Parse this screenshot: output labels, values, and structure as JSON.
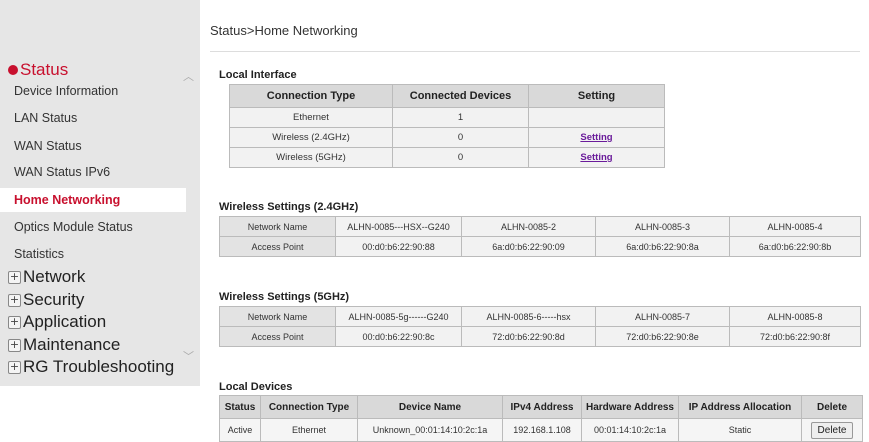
{
  "breadcrumb": "Status>Home Networking",
  "sidebar": {
    "status_label": "Status",
    "status_items": [
      "Device Information",
      "LAN Status",
      "WAN Status",
      "WAN Status IPv6",
      "Home Networking",
      "Optics Module Status",
      "Statistics"
    ],
    "categories": [
      "Network",
      "Security",
      "Application",
      "Maintenance",
      "RG Troubleshooting"
    ]
  },
  "local_interface": {
    "title": "Local Interface",
    "headers": [
      "Connection Type",
      "Connected Devices",
      "Setting"
    ],
    "rows": [
      {
        "type": "Ethernet",
        "devices": "1",
        "setting": ""
      },
      {
        "type": "Wireless (2.4GHz)",
        "devices": "0",
        "setting": "Setting"
      },
      {
        "type": "Wireless (5GHz)",
        "devices": "0",
        "setting": "Setting"
      }
    ]
  },
  "wireless24": {
    "title": "Wireless Settings (2.4GHz)",
    "network_label": "Network Name",
    "ap_label": "Access Point",
    "networks": [
      "ALHN-0085---HSX--G240",
      "ALHN-0085-2",
      "ALHN-0085-3",
      "ALHN-0085-4"
    ],
    "aps": [
      "00:d0:b6:22:90:88",
      "6a:d0:b6:22:90:09",
      "6a:d0:b6:22:90:8a",
      "6a:d0:b6:22:90:8b"
    ]
  },
  "wireless5": {
    "title": "Wireless Settings (5GHz)",
    "network_label": "Network Name",
    "ap_label": "Access Point",
    "networks": [
      "ALHN-0085-5g------G240",
      "ALHN-0085-6-----hsx",
      "ALHN-0085-7",
      "ALHN-0085-8"
    ],
    "aps": [
      "00:d0:b6:22:90:8c",
      "72:d0:b6:22:90:8d",
      "72:d0:b6:22:90:8e",
      "72:d0:b6:22:90:8f"
    ]
  },
  "local_devices": {
    "title": "Local Devices",
    "headers": [
      "Status",
      "Connection Type",
      "Device Name",
      "IPv4 Address",
      "Hardware Address",
      "IP Address Allocation",
      "Delete"
    ],
    "rows": [
      {
        "status": "Active",
        "conn": "Ethernet",
        "name": "Unknown_00:01:14:10:2c:1a",
        "ipv4": "192.168.1.108",
        "hw": "00:01:14:10:2c:1a",
        "alloc": "Static",
        "delete": "Delete"
      }
    ]
  },
  "colors": {
    "accent": "#c8102e",
    "link": "#6a1b9a",
    "sidebar_bg": "#e6e6e6"
  },
  "icons": {
    "collapse": "minus-circle-icon",
    "expand": "plus-box-icon"
  }
}
